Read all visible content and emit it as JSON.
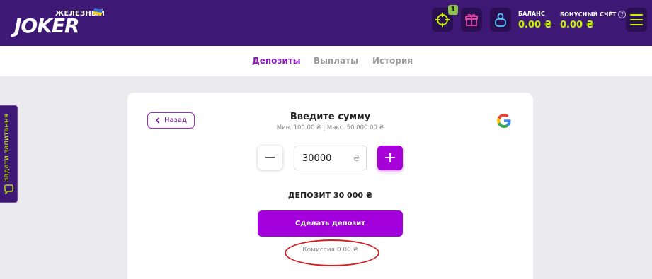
{
  "header": {
    "logo_small": "ЖЕЛЕЗНЫЙ",
    "logo_big": "JOKER",
    "mission_badge": "1",
    "balance": {
      "label": "БАЛАНС",
      "value": "0.00 ₴"
    },
    "bonus": {
      "label": "БОНУСНЫЙ СЧЁТ",
      "help": "?",
      "value": "0.00 ₴"
    }
  },
  "tabs": [
    {
      "label": "Депозиты",
      "active": true
    },
    {
      "label": "Выплаты",
      "active": false
    },
    {
      "label": "История",
      "active": false
    }
  ],
  "deposit": {
    "back_label": "Назад",
    "title": "Введите сумму",
    "limits": "Мин. 100.00 ₴ | Макс. 50 000.00 ₴",
    "minus": "−",
    "plus": "+",
    "amount": "30000",
    "currency": "₴",
    "summary": "ДЕПОЗИТ 30 000 ₴",
    "submit_label": "Сделать депозит",
    "commission": "Комиссия 0.00 ₴"
  },
  "side_tab": {
    "label": "Задати запитання"
  },
  "colors": {
    "header_bg": "#3d1975",
    "accent": "#a300dd",
    "balance_value": "#c6f400",
    "annotation": "#d32024"
  }
}
